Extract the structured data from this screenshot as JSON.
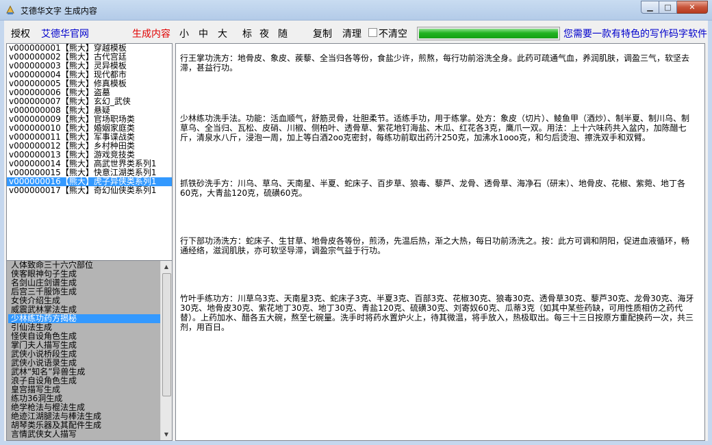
{
  "window": {
    "title": "艾德华文字 生成内容"
  },
  "toolbar": {
    "auth": "授权",
    "site": "艾德华官网",
    "generate": "生成内容",
    "size_small": "小",
    "size_medium": "中",
    "size_large": "大",
    "mark": "标",
    "night": "夜",
    "random": "随",
    "copy": "复制",
    "clear": "清理",
    "no_clear": "不清空",
    "ad": "您需要一款有特色的写作码字软件",
    "progress": 1.0
  },
  "templates": [
    "v000000001【熊大】穿越模板",
    "v000000002【熊大】古代宫廷",
    "v000000003【熊大】灵异模板",
    "v000000004【熊大】现代都市",
    "v000000005【熊大】修真模板",
    "v000000006【熊大】盗墓",
    "v000000007【熊大】玄幻_武侠",
    "v000000008【熊大】悬疑",
    "v000000009【熊大】官场职场类",
    "v000000010【熊大】婚姻家庭类",
    "v000000011【熊大】军事谍战类",
    "v000000012【熊大】乡村种田类",
    "v000000013【熊大】游戏竞技类",
    "v000000014【熊大】高武世界类系列1",
    "v000000015【熊大】快意江湖类系列1",
    "v000000016【熊大】虎子异侠类系列1",
    "v000000017【熊大】奇幻仙侠类系列1"
  ],
  "selected_template": 15,
  "generators": [
    "人体致命三十六穴部位",
    "侠客眼神句子生成",
    "名剑山庄剑谱生成",
    "后宫三千服饰生成",
    "女侠介绍生成",
    "威震武林掌法生成",
    "少林练功药方揭秘",
    "引仙法生成",
    "怪侠自设角色生成",
    "掌门夫人描写生成",
    "武侠小说桥段生成",
    "武侠小说语录生成",
    "武林“知名”异兽生成",
    "浪子自设角色生成",
    "皇宫描写生成",
    "练功36洞生成",
    "绝学枪法与棍法生成",
    "绝迹江湖腿法与棒法生成",
    "胡琴类乐器及其配件生成",
    "言情武侠女人描写"
  ],
  "selected_generator": 6,
  "content": [
    "行王掌功洗方：地骨皮、象皮、蒺藜、全当归各等份，食盐少许，煎熬，每行功前浴洗全身。此药可疏通气血，养润肌肤，调盈三气，软坚去滞，甚益行功。",
    "少林练功洗手法。功能：活血顺气，舒筋灵骨，壮胆柔节。适练手功，用于练掌。处方：象皮（切片）、鲮鱼甲（酒炒）、制半夏、制川乌、制草乌、全当归、瓦松、皮硝、川椒、侧柏叶、透骨草、紫花地钉海盐、木瓜、红花各3克，鹰爪一双。用法：上十六味药共入盆内，加陈醋七斤，清泉水八斤，浸泡一周，加上等白酒2oo克密封，每练功前取出药汁250克，加沸水1ooo克，和匀后烫泡、擦洗双手和双臂。",
    "抓铁砂洗手方：川乌、草乌、天南星、半夏、蛇床子、百步草、狼毒、藜芦、龙骨、透骨草、海净石（研末）、地骨皮、花椒、紫菀、地丁各60克，大青盐120克，硫磺60克。",
    "行下部功汤洗方：蛇床子、生甘草、地骨皮各等份，煎汤，先温后热，渐之大热，每日功前汤洗之。按：此方可调和阴阳，促进血液循环，畅通经络，滋润肌肤，亦可软坚导滞，调盈宗气益于行功。",
    "竹叶手练功方：川草乌3克、天南星3克、蛇床子3克、半夏3克、百部3克、花椒30克、狼毒30克、透骨草30克、藜芦30克、龙骨30克、海牙30克、地骨皮30克、紫花地丁30克、地丁30克、青盐120克、硫磺30克、刘寄奴60克、瓜蒂3克（如其中某些药缺，可用性质相仿之药代替）。上药加水、醋各五大碗，熬至七碗量。洗手时将药水置炉火上，待其微温，将手放入，热极取出。每三十三日按原方重配换药一次，共三剂，用百日。"
  ]
}
